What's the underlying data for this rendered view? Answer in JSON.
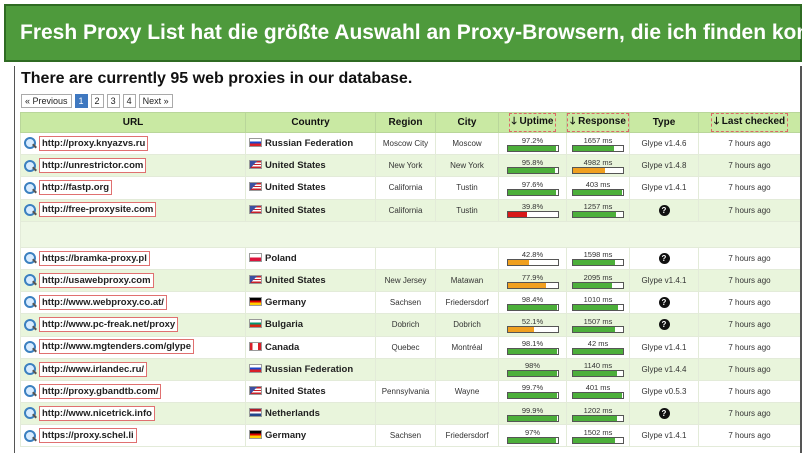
{
  "banner": {
    "title": "Fresh Proxy List hat die größte Auswahl an Proxy-Browsern, die ich finden konnte"
  },
  "headline": "There are currently 95 web proxies in our database.",
  "pagination": {
    "prev": "« Previous",
    "pages": [
      "1",
      "2",
      "3",
      "4"
    ],
    "current": "1",
    "next": "Next »"
  },
  "columns": {
    "url": "URL",
    "country": "Country",
    "region": "Region",
    "city": "City",
    "uptime": "Uptime",
    "response": "Response",
    "type": "Type",
    "last_checked": "Last checked"
  },
  "colors": {
    "green": "#4caf3a",
    "orange": "#f0a020",
    "red": "#d81818",
    "header": "#c9e9a3"
  },
  "rows": [
    {
      "url": "http://proxy.knyazvs.ru",
      "flag": "ru",
      "country": "Russian Federation",
      "region": "Moscow City",
      "city": "Moscow",
      "uptime": "97.2%",
      "uptime_pct": 97.2,
      "uptime_color": "green",
      "response": "1657 ms",
      "response_pct": 0.82,
      "response_color": "green",
      "type": "Glype v1.4.6",
      "last": "7 hours ago"
    },
    {
      "url": "http://unrestrictor.com",
      "flag": "us",
      "country": "United States",
      "region": "New York",
      "city": "New York",
      "uptime": "95.8%",
      "uptime_pct": 95.8,
      "uptime_color": "green",
      "response": "4982 ms",
      "response_pct": 0.64,
      "response_color": "orange",
      "type": "Glype v1.4.8",
      "last": "7 hours ago"
    },
    {
      "url": "http://fastp.org",
      "flag": "us",
      "country": "United States",
      "region": "California",
      "city": "Tustin",
      "uptime": "97.6%",
      "uptime_pct": 97.6,
      "uptime_color": "green",
      "response": "403 ms",
      "response_pct": 0.97,
      "response_color": "green",
      "type": "Glype v1.4.1",
      "last": "7 hours ago"
    },
    {
      "url": "http://free-proxysite.com",
      "flag": "us",
      "country": "United States",
      "region": "California",
      "city": "Tustin",
      "uptime": "39.8%",
      "uptime_pct": 39.8,
      "uptime_color": "red",
      "response": "1257 ms",
      "response_pct": 0.86,
      "response_color": "green",
      "type": "",
      "last": "7 hours ago"
    },
    {
      "spacer": true
    },
    {
      "url": "https://bramka-proxy.pl",
      "flag": "pl",
      "country": "Poland",
      "region": "",
      "city": "",
      "uptime": "42.8%",
      "uptime_pct": 42.8,
      "uptime_color": "orange",
      "response": "1598 ms",
      "response_pct": 0.83,
      "response_color": "green",
      "type": "",
      "last": "7 hours ago"
    },
    {
      "url": "http://usawebproxy.com",
      "flag": "us",
      "country": "United States",
      "region": "New Jersey",
      "city": "Matawan",
      "uptime": "77.9%",
      "uptime_pct": 77.9,
      "uptime_color": "orange",
      "response": "2095 ms",
      "response_pct": 0.78,
      "response_color": "green",
      "type": "Glype v1.4.1",
      "last": "7 hours ago"
    },
    {
      "url": "http://www.webproxy.co.at/",
      "flag": "de",
      "country": "Germany",
      "region": "Sachsen",
      "city": "Friedersdorf",
      "uptime": "98.4%",
      "uptime_pct": 98.4,
      "uptime_color": "green",
      "response": "1010 ms",
      "response_pct": 0.9,
      "response_color": "green",
      "type": "",
      "last": "7 hours ago"
    },
    {
      "url": "http://www.pc-freak.net/proxy",
      "flag": "bg",
      "country": "Bulgaria",
      "region": "Dobrich",
      "city": "Dobrich",
      "uptime": "52.1%",
      "uptime_pct": 52.1,
      "uptime_color": "orange",
      "response": "1507 ms",
      "response_pct": 0.84,
      "response_color": "green",
      "type": "",
      "last": "7 hours ago"
    },
    {
      "url": "http://www.mgtenders.com/glype",
      "flag": "ca",
      "country": "Canada",
      "region": "Quebec",
      "city": "Montréal",
      "uptime": "98.1%",
      "uptime_pct": 98.1,
      "uptime_color": "green",
      "response": "42 ms",
      "response_pct": 1.0,
      "response_color": "green",
      "type": "Glype v1.4.1",
      "last": "7 hours ago"
    },
    {
      "url": "http://www.irlandec.ru/",
      "flag": "ru",
      "country": "Russian Federation",
      "region": "",
      "city": "",
      "uptime": "98%",
      "uptime_pct": 98,
      "uptime_color": "green",
      "response": "1140 ms",
      "response_pct": 0.88,
      "response_color": "green",
      "type": "Glype v1.4.4",
      "last": "7 hours ago"
    },
    {
      "url": "http://proxy.gbandtb.com/",
      "flag": "us",
      "country": "United States",
      "region": "Pennsylvania",
      "city": "Wayne",
      "uptime": "99.7%",
      "uptime_pct": 99.7,
      "uptime_color": "green",
      "response": "401 ms",
      "response_pct": 0.97,
      "response_color": "green",
      "type": "Glype v0.5.3",
      "last": "7 hours ago"
    },
    {
      "url": "http://www.nicetrick.info",
      "flag": "nl",
      "country": "Netherlands",
      "region": "",
      "city": "",
      "uptime": "99.9%",
      "uptime_pct": 99.9,
      "uptime_color": "green",
      "response": "1202 ms",
      "response_pct": 0.87,
      "response_color": "green",
      "type": "",
      "last": "7 hours ago"
    },
    {
      "url": "https://proxy.schel.li",
      "flag": "de",
      "country": "Germany",
      "region": "Sachsen",
      "city": "Friedersdorf",
      "uptime": "97%",
      "uptime_pct": 97,
      "uptime_color": "green",
      "response": "1502 ms",
      "response_pct": 0.84,
      "response_color": "green",
      "type": "Glype v1.4.1",
      "last": "7 hours ago"
    }
  ]
}
